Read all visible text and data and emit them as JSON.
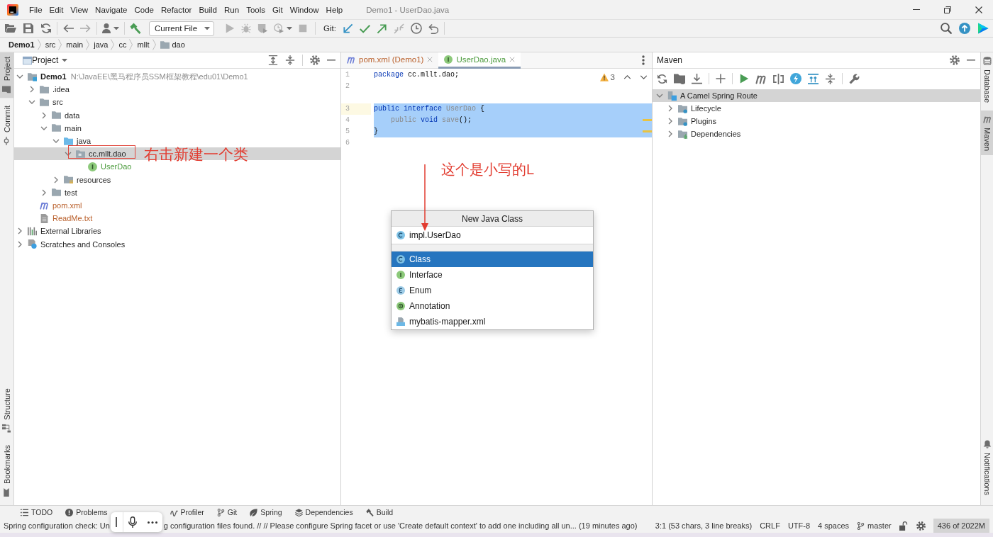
{
  "window": {
    "title": "Demo1 - UserDao.java"
  },
  "menu": [
    "File",
    "Edit",
    "View",
    "Navigate",
    "Code",
    "Refactor",
    "Build",
    "Run",
    "Tools",
    "Git",
    "Window",
    "Help"
  ],
  "toolbar": {
    "run_configuration": "Current File",
    "vcs_label": "Git:"
  },
  "breadcrumbs": [
    {
      "label": "Demo1",
      "kind": "project"
    },
    {
      "label": "src",
      "kind": "dir"
    },
    {
      "label": "main",
      "kind": "dir"
    },
    {
      "label": "java",
      "kind": "dir"
    },
    {
      "label": "cc",
      "kind": "dir"
    },
    {
      "label": "mllt",
      "kind": "dir"
    },
    {
      "label": "dao",
      "kind": "package"
    }
  ],
  "left_stripe": {
    "top": [
      {
        "label": "Project",
        "kind": "project",
        "selected": true
      },
      {
        "label": "Commit",
        "kind": "commit",
        "selected": false
      }
    ],
    "bottom": [
      {
        "label": "Structure",
        "kind": "structure",
        "selected": false
      },
      {
        "label": "Bookmarks",
        "kind": "bookmarks",
        "selected": false
      }
    ]
  },
  "project_panel": {
    "title": "Project",
    "tree": [
      {
        "label": "Demo1",
        "path": "N:\\JavaEE\\黑马程序员SSM框架教程\\edu01\\Demo1",
        "kind": "module",
        "expanded": true,
        "selected": false,
        "children": [
          {
            "label": ".idea",
            "kind": "folder",
            "expanded": false,
            "selected": false
          },
          {
            "label": "src",
            "kind": "folder",
            "expanded": true,
            "selected": false,
            "children": [
              {
                "label": "data",
                "kind": "folder",
                "expanded": false,
                "selected": false
              },
              {
                "label": "main",
                "kind": "folder",
                "expanded": true,
                "selected": false,
                "children": [
                  {
                    "label": "java",
                    "kind": "source_root",
                    "expanded": true,
                    "selected": false,
                    "children": [
                      {
                        "label": "cc.mllt.dao",
                        "kind": "package",
                        "expanded": true,
                        "selected": true,
                        "children": [
                          {
                            "label": "UserDao",
                            "kind": "interface",
                            "color": "#4a9a3b",
                            "selected": false
                          }
                        ]
                      }
                    ]
                  },
                  {
                    "label": "resources",
                    "kind": "resources_root",
                    "expanded": false,
                    "selected": false
                  }
                ]
              },
              {
                "label": "test",
                "kind": "folder",
                "expanded": false,
                "selected": false
              }
            ]
          },
          {
            "label": "pom.xml",
            "kind": "maven",
            "color": "#b95f2a",
            "selected": false
          },
          {
            "label": "ReadMe.txt",
            "kind": "text",
            "color": "#b95f2a",
            "selected": false
          }
        ]
      },
      {
        "label": "External Libraries",
        "kind": "libraries",
        "expanded": false,
        "selected": false
      },
      {
        "label": "Scratches and Consoles",
        "kind": "scratches",
        "expanded": false,
        "selected": false
      }
    ]
  },
  "annotations": [
    {
      "kind": "framed",
      "text": "右击新建一个类"
    },
    {
      "kind": "arrow",
      "text": "这个是小写的L"
    }
  ],
  "editor": {
    "tabs": [
      {
        "label": "pom.xml (Demo1)",
        "kind": "maven",
        "color": "#b95f2a",
        "selected": false
      },
      {
        "label": "UserDao.java",
        "kind": "interface",
        "color": "#4a9a3b",
        "selected": true
      }
    ],
    "warnings": "3",
    "lines": [
      {
        "number": "1",
        "tokens": [
          {
            "text": "package",
            "kind": "keyword"
          },
          {
            "text": " cc.mllt.dao;",
            "kind": "plain"
          }
        ],
        "selected": false,
        "current": false,
        "warning": false
      },
      {
        "number": "2",
        "selected": false,
        "current": false,
        "warning": false
      },
      {
        "number": "3",
        "tokens": [
          {
            "text": "public",
            "kind": "keyword"
          },
          {
            "text": " interface",
            "kind": "keyword"
          },
          {
            "text": " UserDao",
            "kind": "unused"
          },
          {
            "text": " {",
            "kind": "plain"
          }
        ],
        "selected": true,
        "current": true,
        "warning": false
      },
      {
        "number": "4",
        "tokens": [
          {
            "text": "    public",
            "kind": "unused"
          },
          {
            "text": " void",
            "kind": "keyword"
          },
          {
            "text": " save",
            "kind": "unused"
          },
          {
            "text": "();",
            "kind": "plain"
          }
        ],
        "selected": true,
        "current": false,
        "warning": true
      },
      {
        "number": "5",
        "tokens": [
          {
            "text": "}",
            "kind": "plain"
          }
        ],
        "selected": true,
        "current": false,
        "warning": true
      },
      {
        "number": "6",
        "selected": false,
        "current": false,
        "warning": false
      }
    ]
  },
  "new_class_popup": {
    "title": "New Java Class",
    "name_value": "impl.UserDao",
    "options": [
      {
        "label": "Class",
        "kind": "class",
        "selected": true
      },
      {
        "label": "Interface",
        "kind": "interface",
        "selected": false
      },
      {
        "label": "Enum",
        "kind": "enum",
        "selected": false
      },
      {
        "label": "Annotation",
        "kind": "annotation",
        "selected": false
      },
      {
        "label": "mybatis-mapper.xml",
        "kind": "xml_template",
        "selected": false
      }
    ]
  },
  "maven_panel": {
    "title": "Maven",
    "tree": [
      {
        "label": "A Camel Spring Route",
        "kind": "project",
        "expanded": true,
        "selected": true,
        "children": [
          {
            "label": "Lifecycle",
            "kind": "lifecycle",
            "expanded": false,
            "selected": false
          },
          {
            "label": "Plugins",
            "kind": "plugins",
            "expanded": false,
            "selected": false
          },
          {
            "label": "Dependencies",
            "kind": "dependencies",
            "expanded": false,
            "selected": false
          }
        ]
      }
    ]
  },
  "right_stripe": {
    "top": [
      {
        "label": "Database",
        "kind": "database",
        "selected": false
      },
      {
        "label": "Maven",
        "kind": "maven",
        "selected": true
      }
    ],
    "bottom": [
      {
        "label": "Notifications",
        "kind": "notifications",
        "selected": false
      }
    ]
  },
  "tool_tabs": [
    {
      "label": "TODO",
      "kind": "todo"
    },
    {
      "label": "Problems",
      "kind": "problems"
    },
    {
      "label": "Profiler",
      "kind": "profiler"
    },
    {
      "label": "Git",
      "kind": "git"
    },
    {
      "label": "Spring",
      "kind": "spring"
    },
    {
      "label": "Dependencies",
      "kind": "dependencies"
    },
    {
      "label": "Build",
      "kind": "build"
    }
  ],
  "status_bar": {
    "message_parts": [
      "Spring configuration check: Un",
      "g configuration files found. // // Please configure Spring facet or use 'Create default context' to add one including all un... (19 minutes ago)"
    ],
    "caret_position": "3:1 (53 chars, 3 line breaks)",
    "line_separator": "CRLF",
    "encoding": "UTF-8",
    "indent": "4 spaces",
    "branch": "master",
    "memory": "436 of 2022M"
  }
}
